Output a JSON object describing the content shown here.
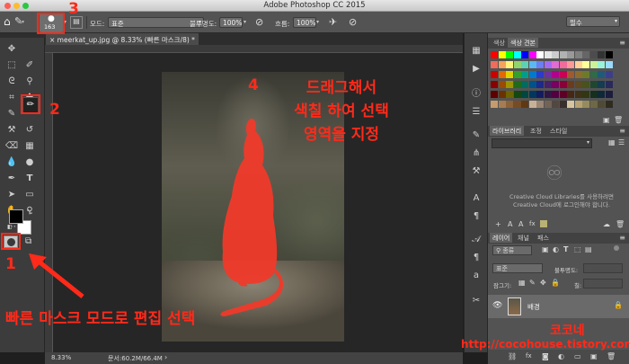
{
  "window": {
    "title": "Adobe Photoshop CC 2015"
  },
  "options_bar": {
    "brush_size": "163",
    "mode_label": "모드:",
    "mode_value": "표준",
    "opacity_label": "불투명도:",
    "opacity_value": "100%",
    "flow_label": "흐름:",
    "flow_value": "100%",
    "workspace_value": "필수"
  },
  "document": {
    "tab_label": "meerkat_up.jpg @ 8.33% (빠른 마스크/8) *",
    "zoom": "8.33%",
    "doc_info": "문서:60.2M/66.4M"
  },
  "panels": {
    "swatches_tabs": [
      "색상",
      "색상 견본"
    ],
    "library_tabs": [
      "라이브러리",
      "조정",
      "스타일"
    ],
    "library_message": "Creative Cloud Libraries를 사용하려면 Creative Cloud에 로그인해야 합니다.",
    "layers_tabs": [
      "레이어",
      "채널",
      "패스"
    ],
    "kind_filter": "종류",
    "blend_mode": "표준",
    "opacity_label": "불투명도:",
    "lock_label": "잠그기:",
    "fill_label": "칠:",
    "layer_name": "배경"
  },
  "annotations": {
    "num1": "1",
    "num2": "2",
    "num3": "3",
    "num4": "4",
    "step4_line1": "드래그해서",
    "step4_line2": "색칠 하여 선택",
    "step4_line3": "영역을 지정",
    "step1_text": "빠른 마스크 모드로 편집 선택",
    "watermark_name": "코코네",
    "watermark_url": "http://cocohouse.tistory.com"
  },
  "colors": {
    "annotation_red": "#ff2a1a",
    "mask_red": "#f03a2a",
    "panel_bg": "#535353"
  }
}
